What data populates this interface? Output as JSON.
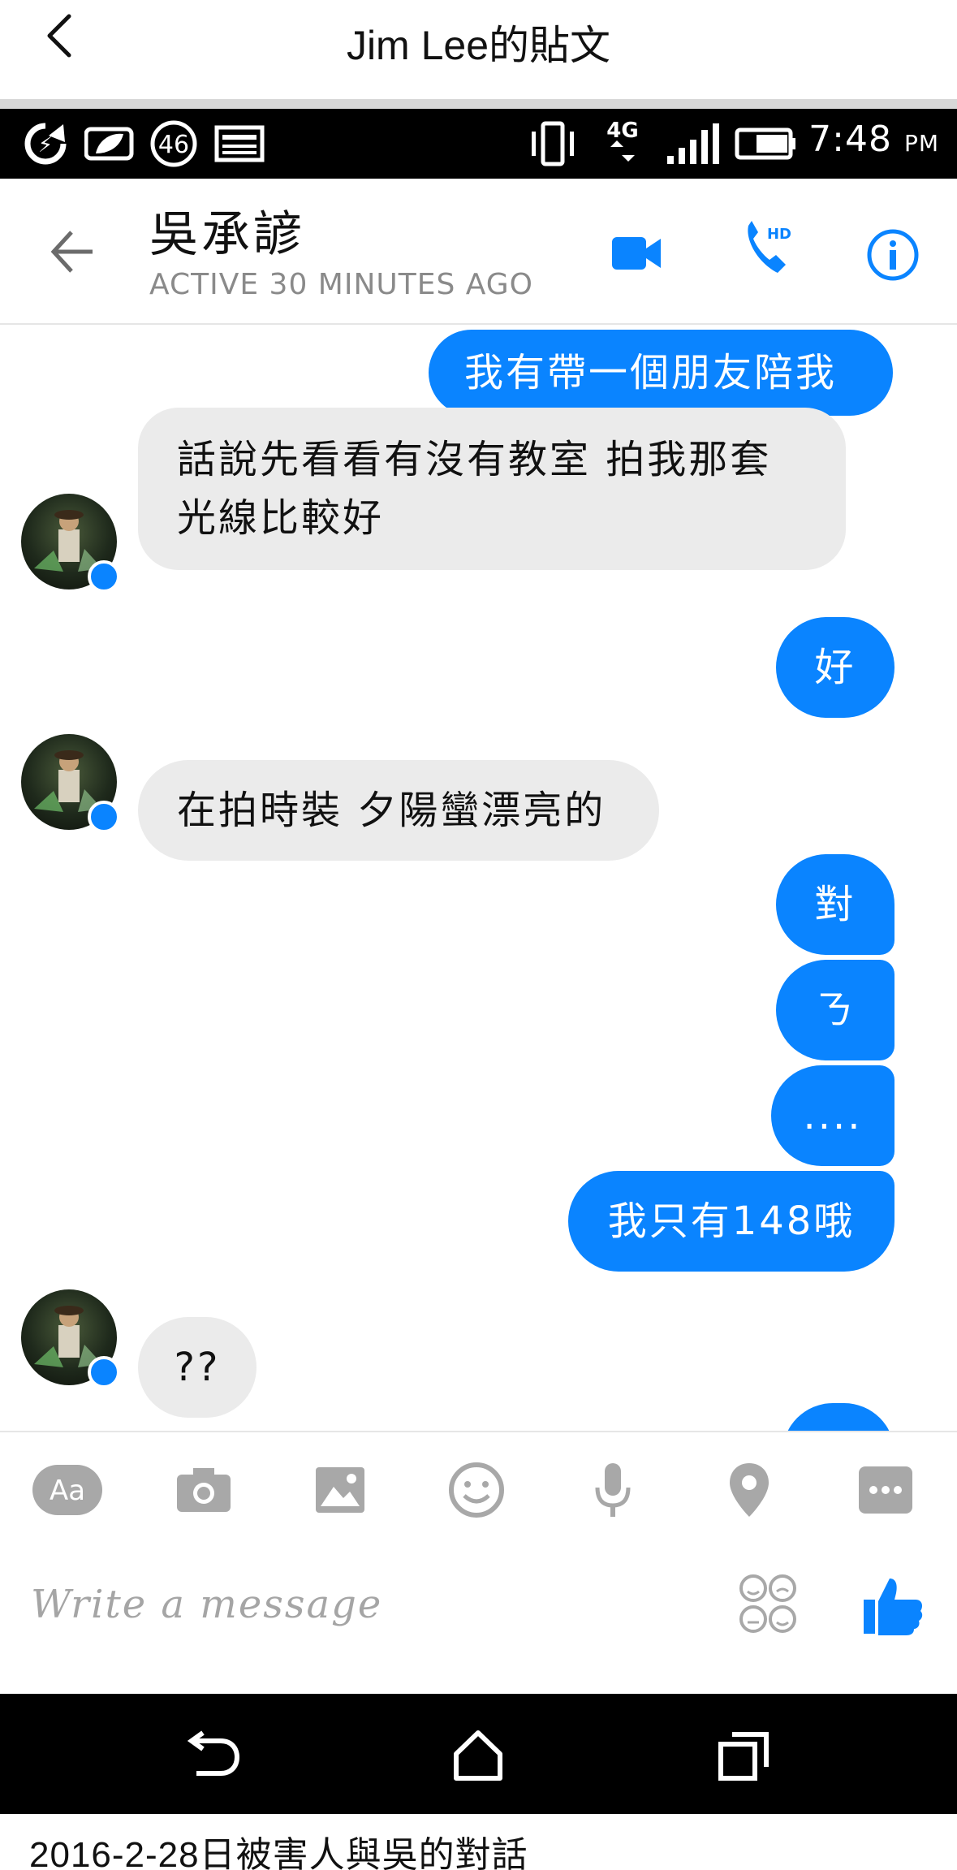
{
  "post": {
    "title": "Jim Lee的貼文",
    "back_icon": "chevron-left-icon"
  },
  "status_bar": {
    "time": "7:48",
    "ampm": "PM",
    "network": "4G",
    "badge_number": "46"
  },
  "chat": {
    "contact_name": "吳承諺",
    "active_status": "ACTIVE 30 MINUTES AGO",
    "accent_color": "#0a84ff"
  },
  "messages": [
    {
      "from": "me",
      "text": "我有帶一個朋友陪我"
    },
    {
      "from": "them",
      "lines": [
        "話說先看看有沒有教室 拍我那套",
        "光線比較好"
      ]
    },
    {
      "from": "me",
      "text": "好"
    },
    {
      "from": "them",
      "text": "在拍時裝 夕陽蠻漂亮的"
    },
    {
      "from": "me",
      "text": "對"
    },
    {
      "from": "me",
      "text": "ㄋ"
    },
    {
      "from": "me",
      "text": "...."
    },
    {
      "from": "me",
      "text": "我只有148哦"
    },
    {
      "from": "them",
      "text": "??"
    }
  ],
  "composer": {
    "placeholder": "Write a message"
  },
  "toolbar": {
    "aa_label": "Aa"
  },
  "caption": "2016-2-28日被害人與吳的對話"
}
